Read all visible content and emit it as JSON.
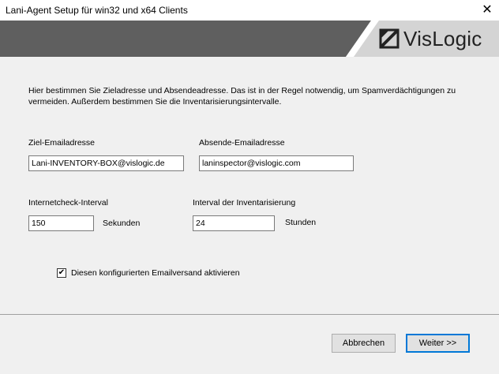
{
  "window": {
    "title": "Lani-Agent Setup für win32 und x64 Clients",
    "close_symbol": "✕"
  },
  "banner": {
    "logo_text": "VisLogic",
    "colors": {
      "dark": "#5f5f5f",
      "light": "#d4d4d4",
      "white_stripe": "#ffffff"
    }
  },
  "intro": {
    "line1": "Hier bestimmen Sie Zieladresse und Absendeadresse. Das ist in der Regel notwendig, um Spamverdächtigungen zu",
    "line2": "vermeiden. Außerdem bestimmen Sie die Inventarisierungsintervalle."
  },
  "fields": {
    "target_email": {
      "label": "Ziel-Emailadresse",
      "value": "Lani-INVENTORY-BOX@vislogic.de"
    },
    "sender_email": {
      "label": "Absende-Emailadresse",
      "value": "laninspector@vislogic.com"
    },
    "internet_check": {
      "label": "Internetcheck-Interval",
      "value": "150",
      "unit": "Sekunden"
    },
    "inventory_interval": {
      "label": "Interval der Inventarisierung",
      "value": "24",
      "unit": "Stunden"
    }
  },
  "checkbox": {
    "label": "Diesen konfigurierten Emailversand aktivieren",
    "checked": true,
    "check_symbol": "✔"
  },
  "buttons": {
    "cancel": "Abbrechen",
    "next": "Weiter >>"
  }
}
